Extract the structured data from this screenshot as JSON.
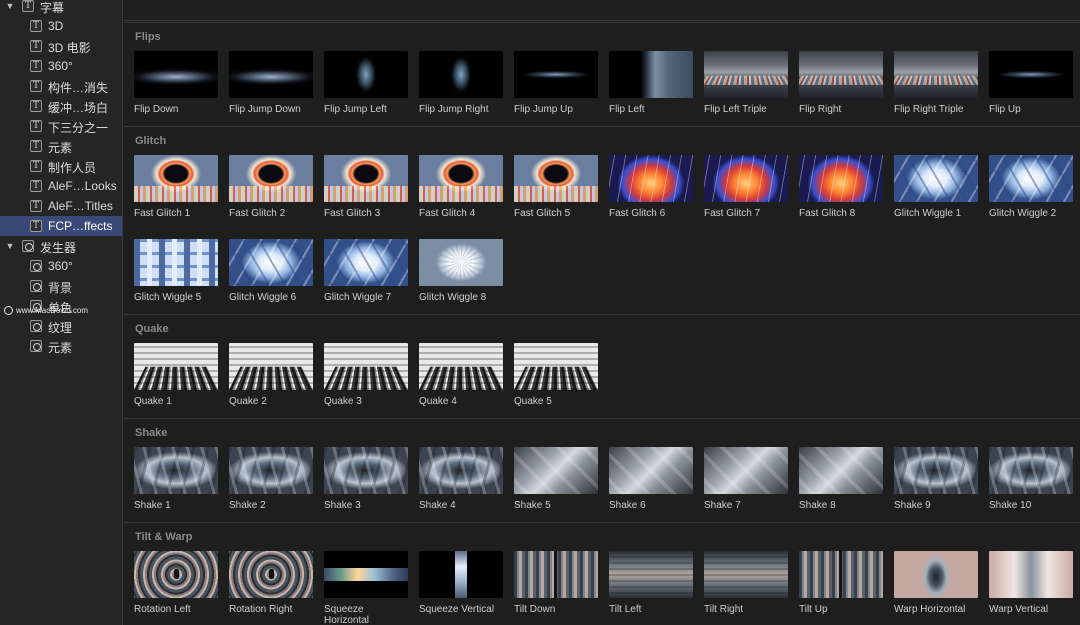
{
  "sidebar": {
    "items": [
      {
        "label": "字幕",
        "type": "titles",
        "level": 0,
        "disclosure": "▼",
        "selected": false
      },
      {
        "label": "3D",
        "type": "titles",
        "level": 1,
        "selected": false
      },
      {
        "label": "3D 电影",
        "type": "titles",
        "level": 1,
        "selected": false
      },
      {
        "label": "360°",
        "type": "titles",
        "level": 1,
        "selected": false
      },
      {
        "label": "构件…消失",
        "type": "titles",
        "level": 1,
        "selected": false
      },
      {
        "label": "缓冲…场白",
        "type": "titles",
        "level": 1,
        "selected": false
      },
      {
        "label": "下三分之一",
        "type": "titles",
        "level": 1,
        "selected": false
      },
      {
        "label": "元素",
        "type": "titles",
        "level": 1,
        "selected": false
      },
      {
        "label": "制作人员",
        "type": "titles",
        "level": 1,
        "selected": false
      },
      {
        "label": "AleF…Looks",
        "type": "titles",
        "level": 1,
        "selected": false
      },
      {
        "label": "AleF…Titles",
        "type": "titles",
        "level": 1,
        "selected": false
      },
      {
        "label": "FCP…ffects",
        "type": "titles",
        "level": 1,
        "selected": true
      },
      {
        "label": "发生器",
        "type": "generator",
        "level": 0,
        "disclosure": "▼",
        "selected": false
      },
      {
        "label": "360°",
        "type": "generator",
        "level": 1,
        "selected": false
      },
      {
        "label": "背景",
        "type": "generator",
        "level": 1,
        "selected": false
      },
      {
        "label": "单色",
        "type": "generator",
        "level": 1,
        "selected": false
      },
      {
        "label": "纹理",
        "type": "generator",
        "level": 1,
        "selected": false
      },
      {
        "label": "元素",
        "type": "generator",
        "level": 1,
        "selected": false
      }
    ],
    "icons": {
      "titles": "T-titles-icon",
      "generator": "generator-icon"
    }
  },
  "watermark": {
    "text": "www.MacDown.com"
  },
  "sections": [
    {
      "title": "Flips",
      "items": [
        {
          "label": "Flip Down",
          "style": "t-flip-wide"
        },
        {
          "label": "Flip Jump Down",
          "style": "t-flip-wide"
        },
        {
          "label": "Flip Jump Left",
          "style": "t-flip-narrow"
        },
        {
          "label": "Flip Jump Right",
          "style": "t-flip-narrow"
        },
        {
          "label": "Flip Jump Up",
          "style": "t-flip-thin"
        },
        {
          "label": "Flip Left",
          "style": "t-flip-left"
        },
        {
          "label": "Flip Left Triple",
          "style": "t-city"
        },
        {
          "label": "Flip Right",
          "style": "t-city"
        },
        {
          "label": "Flip Right Triple",
          "style": "t-city"
        },
        {
          "label": "Flip Up",
          "style": "t-flip-thin"
        }
      ]
    },
    {
      "title": "Glitch",
      "items": [
        {
          "label": "Fast Glitch 1",
          "style": "t-glitch-tunnel"
        },
        {
          "label": "Fast Glitch 2",
          "style": "t-glitch-tunnel"
        },
        {
          "label": "Fast Glitch 3",
          "style": "t-glitch-tunnel"
        },
        {
          "label": "Fast Glitch 4",
          "style": "t-glitch-tunnel"
        },
        {
          "label": "Fast Glitch 5",
          "style": "t-glitch-tunnel"
        },
        {
          "label": "Fast Glitch 6",
          "style": "t-glitch-hot"
        },
        {
          "label": "Fast Glitch 7",
          "style": "t-glitch-hot"
        },
        {
          "label": "Fast Glitch 8",
          "style": "t-glitch-hot"
        },
        {
          "label": "Glitch Wiggle 1",
          "style": "t-glitch-ice"
        },
        {
          "label": "Glitch Wiggle 2",
          "style": "t-glitch-ice"
        },
        {
          "label": "Glitch Wiggle 5",
          "style": "t-glitch-px"
        },
        {
          "label": "Glitch Wiggle 6",
          "style": "t-glitch-ice"
        },
        {
          "label": "Glitch Wiggle 7",
          "style": "t-glitch-ice"
        },
        {
          "label": "Glitch Wiggle 8",
          "style": "t-glitch-bright"
        }
      ]
    },
    {
      "title": "Quake",
      "items": [
        {
          "label": "Quake 1",
          "style": "t-quake"
        },
        {
          "label": "Quake 2",
          "style": "t-quake"
        },
        {
          "label": "Quake 3",
          "style": "t-quake"
        },
        {
          "label": "Quake 4",
          "style": "t-quake"
        },
        {
          "label": "Quake 5",
          "style": "t-quake"
        }
      ]
    },
    {
      "title": "Shake",
      "items": [
        {
          "label": "Shake 1",
          "style": "t-shake"
        },
        {
          "label": "Shake 2",
          "style": "t-shake"
        },
        {
          "label": "Shake 3",
          "style": "t-shake"
        },
        {
          "label": "Shake 4",
          "style": "t-shake"
        },
        {
          "label": "Shake 5",
          "style": "t-shake-blur"
        },
        {
          "label": "Shake 6",
          "style": "t-shake-blur"
        },
        {
          "label": "Shake 7",
          "style": "t-shake-blur"
        },
        {
          "label": "Shake 8",
          "style": "t-shake-blur"
        },
        {
          "label": "Shake 9",
          "style": "t-shake"
        },
        {
          "label": "Shake 10",
          "style": "t-shake"
        }
      ]
    },
    {
      "title": "Tilt & Warp",
      "items": [
        {
          "label": "Rotation Left",
          "style": "t-rotation"
        },
        {
          "label": "Rotation Right",
          "style": "t-rotation"
        },
        {
          "label": "Squeeze Horizontal",
          "style": "t-squeeze-h"
        },
        {
          "label": "Squeeze Vertical",
          "style": "t-squeeze-v"
        },
        {
          "label": "Tilt Down",
          "style": "t-tilt"
        },
        {
          "label": "Tilt Left",
          "style": "t-tilt-h"
        },
        {
          "label": "Tilt Right",
          "style": "t-tilt-h"
        },
        {
          "label": "Tilt Up",
          "style": "t-tilt"
        },
        {
          "label": "Warp Horizontal",
          "style": "t-warp-h"
        },
        {
          "label": "Warp Vertical",
          "style": "t-warp-v"
        }
      ]
    }
  ],
  "colors": {
    "selection": "#3a4a78",
    "background": "#1e1e1e",
    "sidebar": "#252525",
    "section_title": "#8a8a8a"
  }
}
